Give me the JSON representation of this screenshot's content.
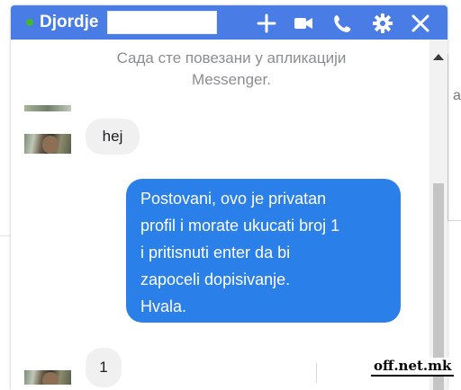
{
  "chat": {
    "contact_name": "Djordje",
    "status_color": "#42b72a",
    "header_color": "#4a7ce6",
    "header_icons": [
      "plus-icon",
      "video-camera-icon",
      "phone-icon",
      "gear-icon",
      "close-icon"
    ]
  },
  "messages": {
    "system_line1": "Сада сте повезани у апликацији",
    "system_line2": "Messenger.",
    "incoming_1": "hej",
    "outgoing_1": [
      "Postovani, ovo je privatan",
      "profil i morate ukucati broj 1",
      "i pritisnuti enter da bi",
      "zapoceli dopisivanje.",
      "Hvala."
    ],
    "incoming_2": "1",
    "incoming_color": "#f1f0f0",
    "outgoing_color": "#2b7fe8"
  },
  "background": {
    "partial_letter": "a"
  },
  "watermark": "off.net.mk"
}
